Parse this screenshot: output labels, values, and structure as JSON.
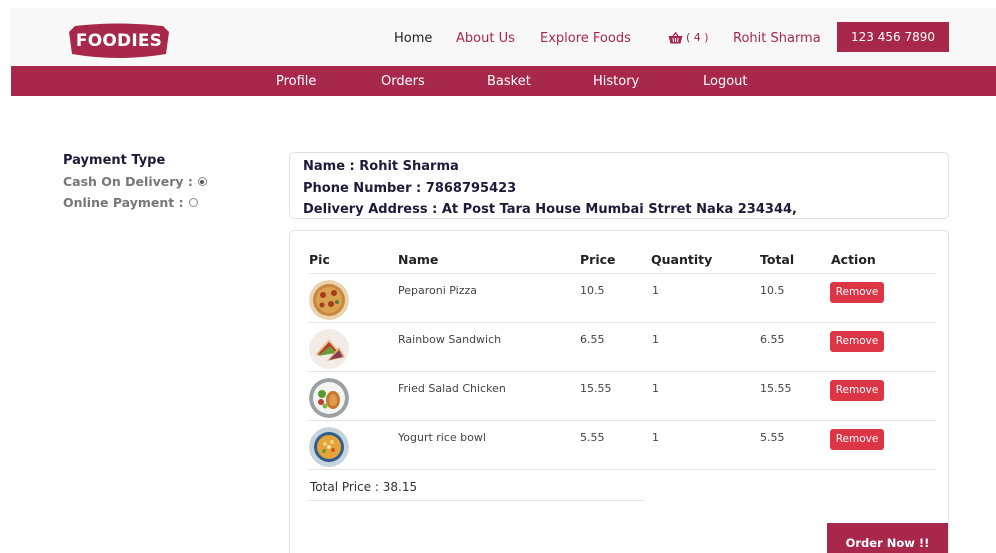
{
  "header": {
    "logo_text": "FOODIES",
    "nav": {
      "home": "Home",
      "about": "About Us",
      "explore": "Explore Foods",
      "basket_icon": "basket-icon",
      "basket_count": "( 4 )",
      "user": "Rohit Sharma"
    },
    "phone": "123 456 7890"
  },
  "subnav": {
    "profile": "Profile",
    "orders": "Orders",
    "basket": "Basket",
    "history": "History",
    "logout": "Logout"
  },
  "payment": {
    "title": "Payment Type",
    "cash": "Cash On Delivery :",
    "online": "Online Payment :",
    "selected": "cash"
  },
  "customer": {
    "name": "Name : Rohit Sharma",
    "phone": "Phone Number : 7868795423",
    "address": "Delivery Address : At Post Tara House Mumbai Strret Naka 234344,"
  },
  "cart": {
    "headers": {
      "pic": "Pic",
      "name": "Name",
      "price": "Price",
      "quantity": "Quantity",
      "total": "Total",
      "action": "Action"
    },
    "items": [
      {
        "name": "Peparoni Pizza",
        "price": "10.5",
        "quantity": "1",
        "total": "10.5",
        "action": "Remove"
      },
      {
        "name": "Rainbow Sandwich",
        "price": "6.55",
        "quantity": "1",
        "total": "6.55",
        "action": "Remove"
      },
      {
        "name": "Fried Salad Chicken",
        "price": "15.55",
        "quantity": "1",
        "total": "15.55",
        "action": "Remove"
      },
      {
        "name": "Yogurt rice bowl",
        "price": "5.55",
        "quantity": "1",
        "total": "5.55",
        "action": "Remove"
      }
    ],
    "total_price": "Total Price : 38.15",
    "order_button": "Order Now !!"
  },
  "colors": {
    "brand": "#a8284c",
    "remove": "#dc3545"
  }
}
